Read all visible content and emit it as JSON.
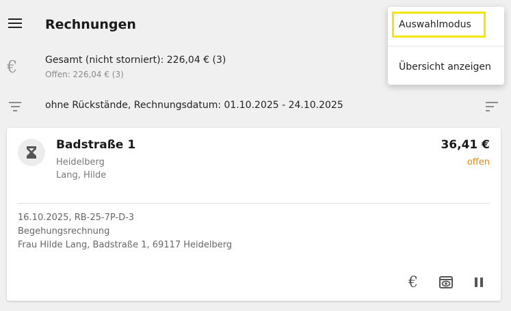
{
  "header": {
    "title": "Rechnungen"
  },
  "summary": {
    "total": "Gesamt (nicht storniert): 226,04 € (3)",
    "open": "Offen: 226,04 € (3)"
  },
  "filter": {
    "text": "ohne Rückstände, Rechnungsdatum: 01.10.2025 - 24.10.2025"
  },
  "invoice": {
    "title": "Badstraße 1",
    "city": "Heidelberg",
    "person": "Lang, Hilde",
    "amount": "36,41 €",
    "status": "offen",
    "status_color": "#e8870e",
    "details": [
      "16.10.2025, RB-25-7P-D-3",
      "Begehungsrechnung",
      "Frau Hilde Lang, Badstraße 1, 69117 Heidelberg"
    ]
  },
  "icons": {
    "menu": "menu-icon",
    "summary": "euro-icon",
    "filter": "filter-icon",
    "sort": "sort-icon",
    "status": "hourglass-icon",
    "actions": [
      "euro-icon",
      "preview-icon",
      "pause-icon"
    ]
  },
  "menu": {
    "items": [
      "Auswahlmodus",
      "Übersicht anzeigen"
    ],
    "highlight_color": "#f5e600"
  }
}
